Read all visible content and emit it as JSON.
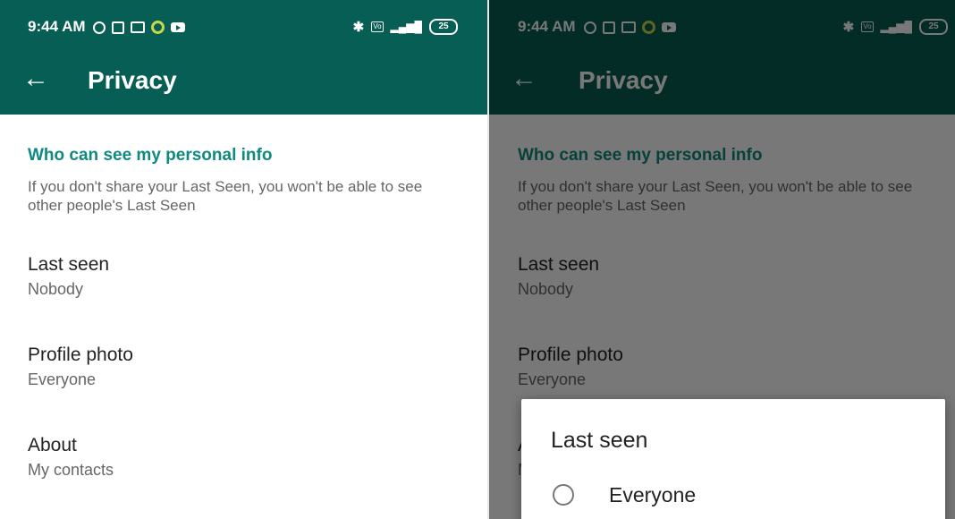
{
  "status": {
    "time": "9:44 AM",
    "battery": "25",
    "icons": [
      "alarm-icon",
      "calendar-icon",
      "mail-icon",
      "ring-icon",
      "youtube-icon",
      "bluetooth-icon",
      "volte-icon",
      "signal-icon",
      "battery-icon"
    ]
  },
  "appbar": {
    "title": "Privacy"
  },
  "privacy": {
    "section_title": "Who can see my personal info",
    "section_desc": "If you don't share your Last Seen, you won't be able to see other people's Last Seen",
    "settings": [
      {
        "label": "Last seen",
        "value": "Nobody"
      },
      {
        "label": "Profile photo",
        "value": "Everyone"
      },
      {
        "label": "About",
        "value": "My contacts"
      }
    ]
  },
  "dialog": {
    "title": "Last seen",
    "options": [
      {
        "label": "Everyone",
        "selected": false
      }
    ]
  },
  "colors": {
    "primary": "#075e54",
    "accent": "#0f8a7e"
  }
}
